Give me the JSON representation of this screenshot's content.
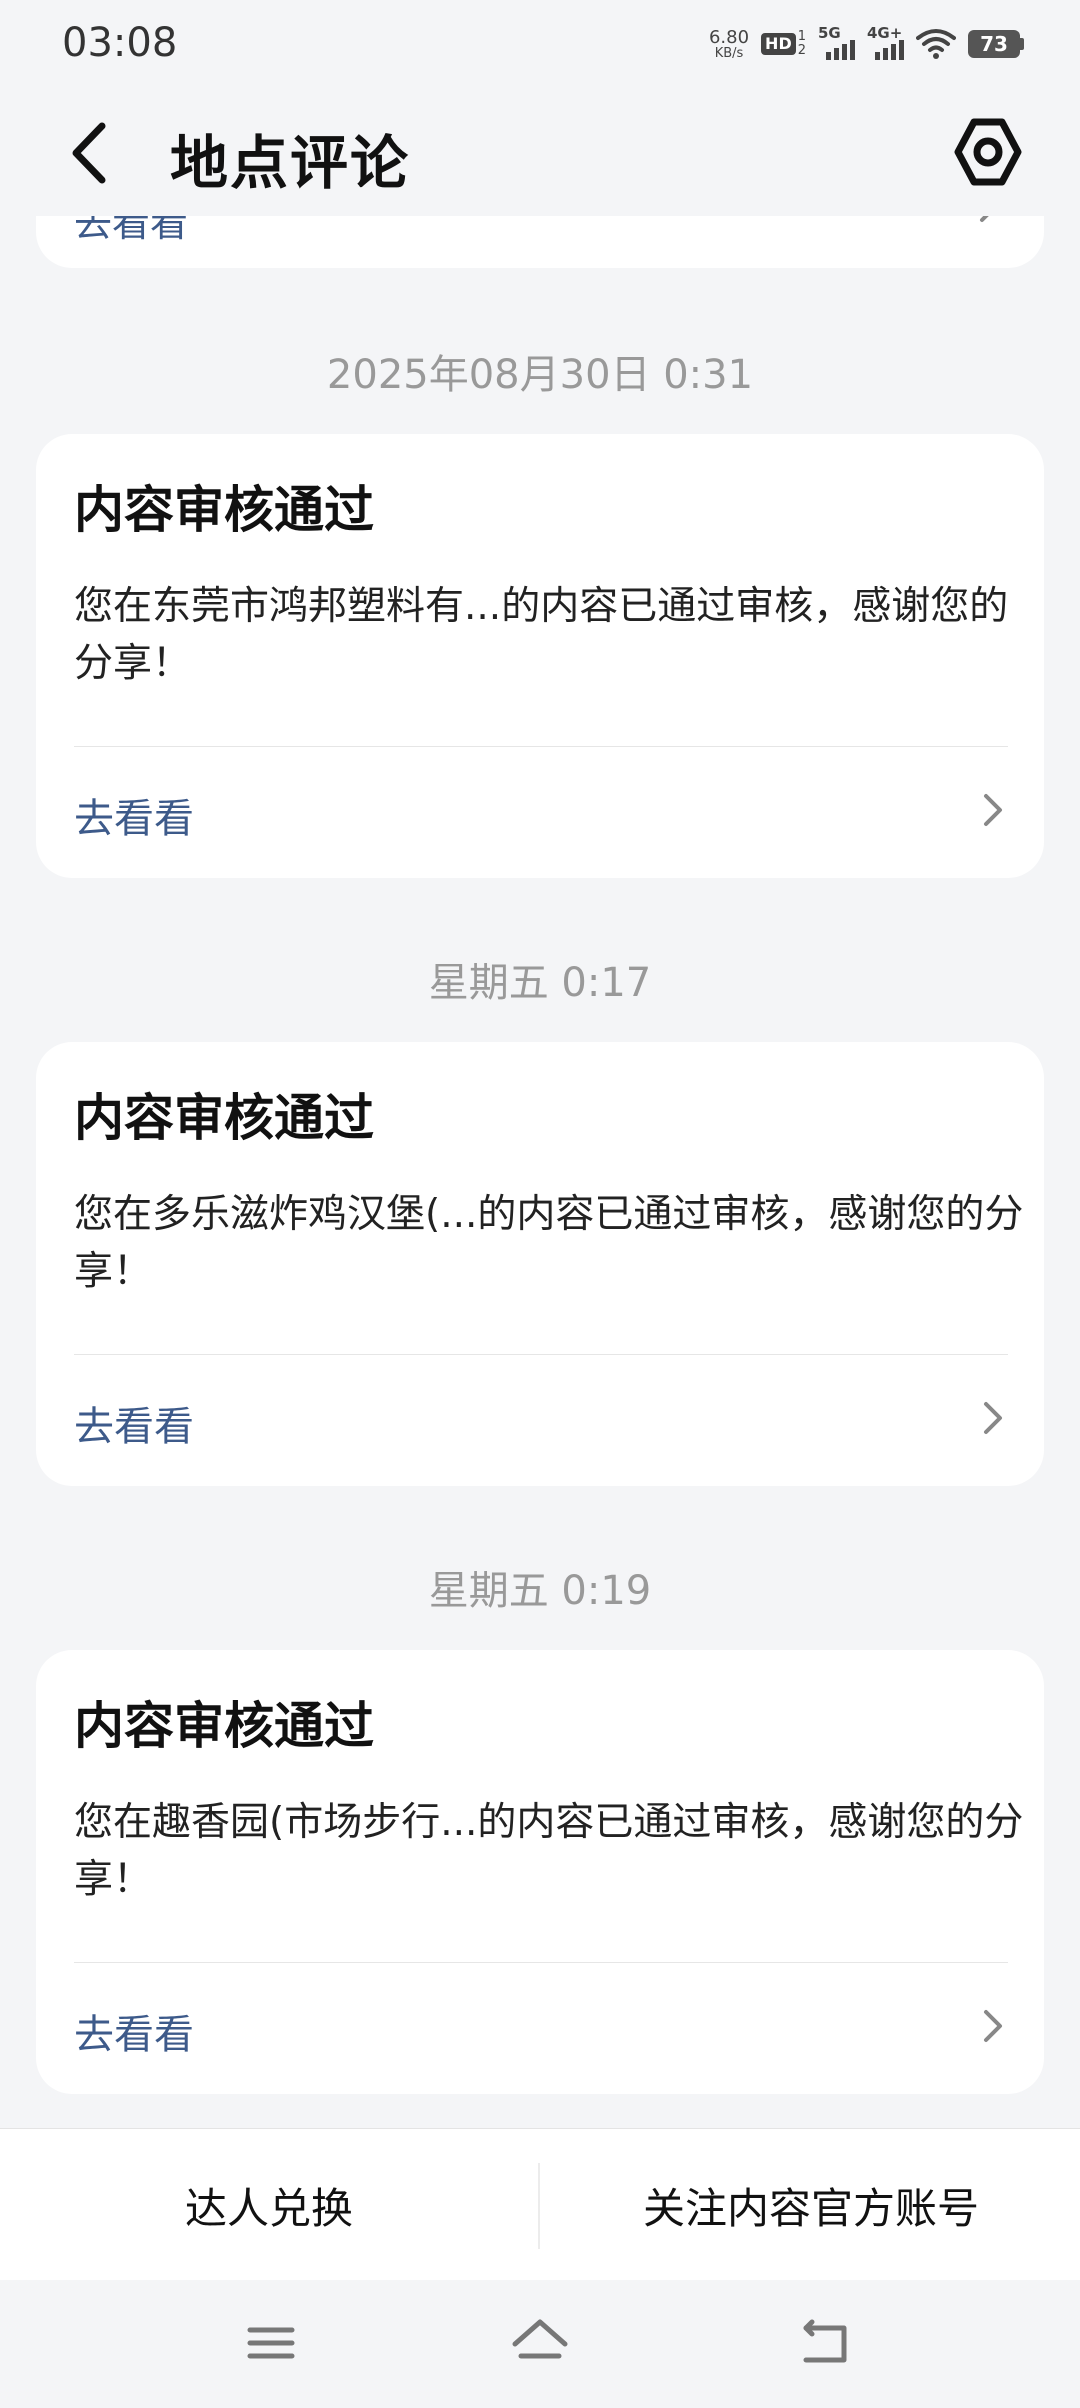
{
  "status_bar": {
    "time": "03:08",
    "net_speed_value": "6.80",
    "net_speed_unit": "KB/s",
    "hd_label": "HD",
    "hd_sub_top": "1",
    "hd_sub_bottom": "2",
    "signal1_label": "5G",
    "signal2_label": "4G+",
    "battery": "73"
  },
  "header": {
    "title": "地点评论"
  },
  "partial_card": {
    "link": "去看看"
  },
  "messages": [
    {
      "timestamp": "2025年08月30日 0:31",
      "title": "内容审核通过",
      "body": "您在东莞市鸿邦塑料有...的内容已通过审核，感谢您的分享！",
      "link": "去看看"
    },
    {
      "timestamp": "星期五 0:17",
      "title": "内容审核通过",
      "body": "您在多乐滋炸鸡汉堡(...的内容已通过审核，感谢您的分享！",
      "link": "去看看"
    },
    {
      "timestamp": "星期五 0:19",
      "title": "内容审核通过",
      "body": "您在趣香园(市场步行...的内容已通过审核，感谢您的分享！",
      "link": "去看看"
    }
  ],
  "actions": {
    "left": "达人兑换",
    "right": "关注内容官方账号"
  },
  "colors": {
    "background": "#f4f5f7",
    "link": "#3d5a8a",
    "timestamp": "#999999"
  }
}
